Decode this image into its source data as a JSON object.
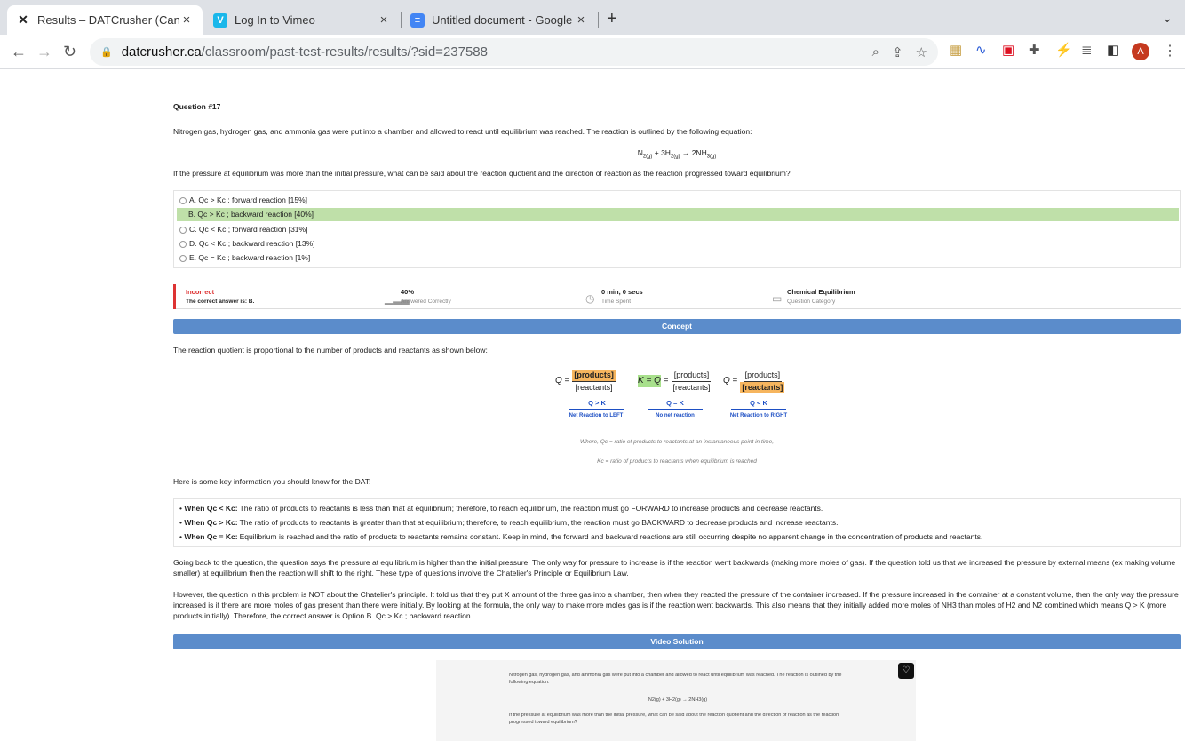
{
  "browser": {
    "tabs": [
      {
        "title": "Results – DATCrusher (Canada)",
        "icon": "x-logo-icon"
      },
      {
        "title": "Log In to Vimeo",
        "icon": "vimeo-icon"
      },
      {
        "title": "Untitled document - Google Docs",
        "icon": "docs-icon"
      }
    ],
    "url_domain": "datcrusher.ca",
    "url_path": "/classroom/past-test-results/results/?sid=237588",
    "avatar_letter": "A"
  },
  "question": {
    "number": "Question #17",
    "stem": "Nitrogen gas, hydrogen gas, and ammonia gas were put into a chamber and allowed to react until equilibrium was reached. The reaction is outlined by the following equation:",
    "equation": "N2(g) + 3H2(g) → 2NH3(g)",
    "prompt": "If the pressure at equilibrium was more than the initial pressure, what can be said about the reaction quotient and the direction of reaction as the reaction progressed toward equilibrium?",
    "options": [
      {
        "label": "A. Qc > Kc ; forward reaction [15%]",
        "correct": false
      },
      {
        "label": "B. Qc > Kc ; backward reaction [40%]",
        "correct": true
      },
      {
        "label": "C. Qc < Kc ; forward reaction [31%]",
        "correct": false
      },
      {
        "label": "D. Qc < Kc ; backward reaction [13%]",
        "correct": false
      },
      {
        "label": "E. Qc = Kc ; backward reaction [1%]",
        "correct": false
      }
    ]
  },
  "stats": {
    "result": "Incorrect",
    "result_sub": "The correct answer is: B.",
    "percent": "40%",
    "percent_sub": "Answered Correctly",
    "time": "0 min, 0 secs",
    "time_sub": "Time Spent",
    "category": "Chemical Equilibrium",
    "category_sub": "Question Category"
  },
  "concept": {
    "header": "Concept",
    "intro": "The reaction quotient is proportional to the number of products and reactants as shown below:",
    "diagram": {
      "q_gt_k": "Q > K",
      "left": "Net Reaction to LEFT",
      "q_eq_k": "Q = K",
      "none": "No net reaction",
      "q_lt_k": "Q < K",
      "right": "Net Reaction to RIGHT",
      "products": "[products]",
      "reactants": "[reactants]",
      "colors": {
        "highlight": "#f6b55e",
        "green": "#a8e08c",
        "arrow": "#1d4fc4"
      }
    },
    "note1": "Where, Qc = ratio of products to reactants at an instantaneous point in time,",
    "note2": "Kc = ratio of products to reactants when equilibrium is reached",
    "key_intro": "Here is some key information you should know for the DAT:",
    "key_items": [
      {
        "bold": "When Qc < Kc:",
        "text": "The ratio of products to reactants is less than that at equilibrium; therefore, to reach equilibrium, the reaction must go FORWARD to increase products and decrease reactants."
      },
      {
        "bold": "When Qc > Kc:",
        "text": "The ratio of products to reactants is greater than that at equilibrium; therefore, to reach equilibrium, the reaction must go BACKWARD to decrease products and increase reactants."
      },
      {
        "bold": "When Qc = Kc:",
        "text": "Equilibrium is reached and the ratio of products to reactants remains constant. Keep in mind, the forward and backward reactions are still occurring despite no apparent change in the concentration of products and reactants."
      }
    ],
    "para1": "Going back to the question, the question says the pressure at equilibrium is higher than the initial pressure. The only way for pressure to increase is if the reaction went backwards (making more moles of gas). If the question told us that we increased the pressure by external means (ex making volume smaller) at equilibrium then the reaction will shift to the right. These type of questions involve the Chatelier's Principle or Equilibrium Law.",
    "para2": "However, the question in this problem is NOT about the Chatelier's principle. It told us that they put X amount of the three gas into a chamber, then when they reacted the pressure of the container increased. If the pressure increased in the container at a constant volume, then the only way the pressure increased is if there are more moles of gas present than there were initially. By looking at the formula, the only way to make more moles gas is if the reaction went backwards. This also means that they initially added more moles of NH3 than moles of H2 and N2 combined which means Q > K (more products initially). Therefore, the correct answer is Option B. Qc > Kc ; backward reaction."
  },
  "video": {
    "header": "Video Solution",
    "line1": "Nitrogen gas, hydrogen gas, and ammonia gas were put into a chamber and allowed to react until equilibrium was reached. The reaction is outlined by the following equation:",
    "line2": "N2(g) + 3H2(g) → 2NH3(g)",
    "line3": "If the pressure at equilibrium was more than the initial pressure, what can be said about the reaction quotient and the direction of reaction as the reaction progressed toward equilibrium?"
  }
}
